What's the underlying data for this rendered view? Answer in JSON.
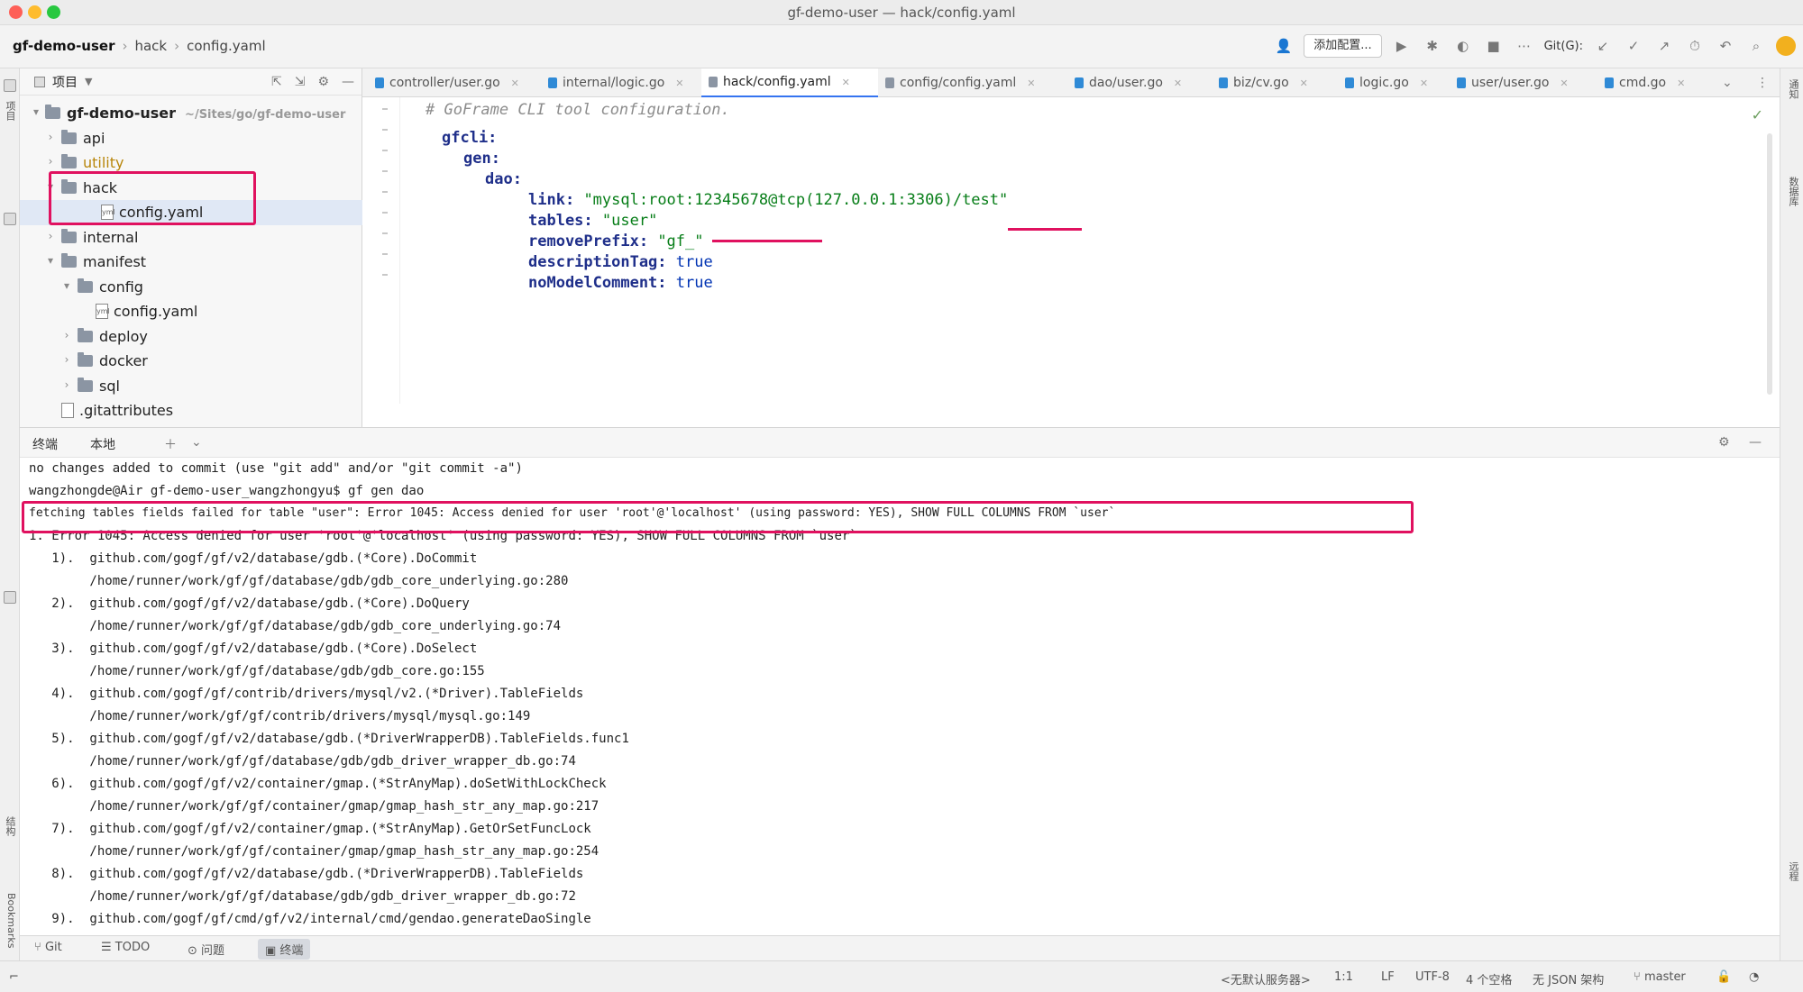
{
  "window": {
    "title": "gf-demo-user — hack/config.yaml"
  },
  "breadcrumb": {
    "root": "gf-demo-user",
    "folder": "hack",
    "file": "config.yaml"
  },
  "toolbar": {
    "add_config_label": "添加配置...",
    "vcs_label": "Git(G):"
  },
  "project_panel": {
    "title": "项目"
  },
  "tree": {
    "root": "gf-demo-user",
    "root_hint": "~/Sites/go/gf-demo-user",
    "items": [
      {
        "label": "api"
      },
      {
        "label": "utility"
      },
      {
        "label": "hack"
      },
      {
        "label": "config.yaml"
      },
      {
        "label": "internal"
      },
      {
        "label": "manifest"
      },
      {
        "label": "config"
      },
      {
        "label": "config.yaml"
      },
      {
        "label": "deploy"
      },
      {
        "label": "docker"
      },
      {
        "label": "sql"
      },
      {
        "label": ".gitattributes"
      }
    ]
  },
  "editor_tabs": [
    {
      "label": "controller/user.go",
      "color": "#2f8ad6"
    },
    {
      "label": "internal/logic.go",
      "color": "#2f8ad6"
    },
    {
      "label": "hack/config.yaml",
      "color": "#8b95a3",
      "active": true
    },
    {
      "label": "config/config.yaml",
      "color": "#8b95a3"
    },
    {
      "label": "dao/user.go",
      "color": "#2f8ad6"
    },
    {
      "label": "biz/cv.go",
      "color": "#2f8ad6"
    },
    {
      "label": "logic.go",
      "color": "#2f8ad6"
    },
    {
      "label": "user/user.go",
      "color": "#2f8ad6"
    },
    {
      "label": "cmd.go",
      "color": "#2f8ad6"
    }
  ],
  "code": {
    "comment": "# GoFrame CLI tool configuration.",
    "gfcli": "gfcli:",
    "gen": "gen:",
    "dao": "dao:",
    "link_key": "link:",
    "link_val": "\"mysql:root:12345678@tcp(127.0.0.1:3306)/test\"",
    "tables_key": "tables:",
    "tables_val": "\"user\"",
    "remove_key": "removePrefix:",
    "remove_val": "\"gf_\"",
    "desc_key": "descriptionTag:",
    "desc_val": "true",
    "nomodel_key": "noModelComment:",
    "nomodel_val": "true"
  },
  "terminal": {
    "tabs": [
      "终端",
      "本地"
    ],
    "lines": [
      "no changes added to commit (use \"git add\" and/or \"git commit -a\")",
      "wangzhongde@Air gf-demo-user_wangzhongyu$ gf gen dao",
      "fetching tables fields failed for table \"user\": Error 1045: Access denied for user 'root'@'localhost' (using password: YES), SHOW FULL COLUMNS FROM `user`",
      "1. Error 1045: Access denied for user 'root'@'localhost' (using password: YES), SHOW FULL COLUMNS FROM `user`",
      "   1).  github.com/gogf/gf/v2/database/gdb.(*Core).DoCommit",
      "        /home/runner/work/gf/gf/database/gdb/gdb_core_underlying.go:280",
      "   2).  github.com/gogf/gf/v2/database/gdb.(*Core).DoQuery",
      "        /home/runner/work/gf/gf/database/gdb/gdb_core_underlying.go:74",
      "   3).  github.com/gogf/gf/v2/database/gdb.(*Core).DoSelect",
      "        /home/runner/work/gf/gf/database/gdb/gdb_core.go:155",
      "   4).  github.com/gogf/gf/contrib/drivers/mysql/v2.(*Driver).TableFields",
      "        /home/runner/work/gf/gf/contrib/drivers/mysql/mysql.go:149",
      "   5).  github.com/gogf/gf/v2/database/gdb.(*DriverWrapperDB).TableFields.func1",
      "        /home/runner/work/gf/gf/database/gdb/gdb_driver_wrapper_db.go:74",
      "   6).  github.com/gogf/gf/v2/container/gmap.(*StrAnyMap).doSetWithLockCheck",
      "        /home/runner/work/gf/gf/container/gmap/gmap_hash_str_any_map.go:217",
      "   7).  github.com/gogf/gf/v2/container/gmap.(*StrAnyMap).GetOrSetFuncLock",
      "        /home/runner/work/gf/gf/container/gmap/gmap_hash_str_any_map.go:254",
      "   8).  github.com/gogf/gf/v2/database/gdb.(*DriverWrapperDB).TableFields",
      "        /home/runner/work/gf/gf/database/gdb/gdb_driver_wrapper_db.go:72",
      "   9).  github.com/gogf/gf/cmd/gf/v2/internal/cmd/gendao.generateDaoSingle"
    ]
  },
  "bottom_tools": [
    "Git",
    "TODO",
    "问题",
    "终端"
  ],
  "status": {
    "schema": "<无默认服务器>",
    "position": "1:1",
    "line_sep": "LF",
    "encoding": "UTF-8",
    "indent": "4 个空格",
    "schema2": "无 JSON 架构",
    "branch": "master"
  },
  "colors": {
    "accent": "#3574f0",
    "highlight": "#e0115f"
  }
}
